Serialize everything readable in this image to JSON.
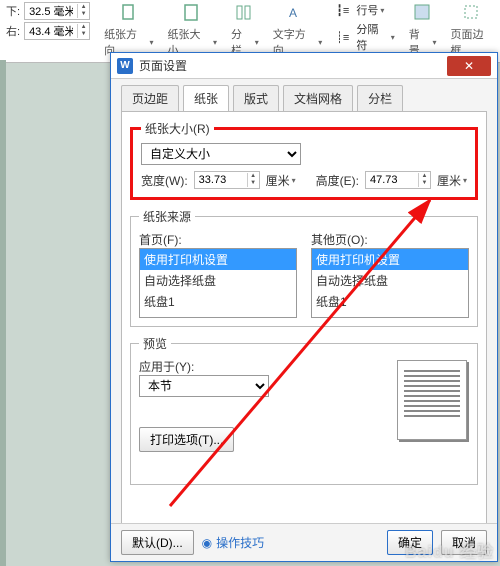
{
  "ribbon": {
    "margins": {
      "btm_label": "下:",
      "btm_value": "32.5 毫米",
      "right_label": "右:",
      "right_value": "43.4 毫米"
    },
    "items": {
      "orient": "纸张方向",
      "size": "纸张大小",
      "columns": "分栏",
      "textdir": "文字方向",
      "lineno_icon": "┇≡",
      "lineno": "行号",
      "sep_icon": "┊≡",
      "sep": "分隔符",
      "bg": "背景",
      "border": "页面边框"
    }
  },
  "dialog": {
    "title": "页面设置",
    "tabs": {
      "t1": "页边距",
      "t2": "纸张",
      "t3": "版式",
      "t4": "文档网格",
      "t5": "分栏"
    },
    "paper_size": {
      "legend": "纸张大小(R)",
      "select_value": "自定义大小",
      "width_label": "宽度(W):",
      "width_value": "33.73",
      "height_label": "高度(E):",
      "height_value": "47.73",
      "unit": "厘米"
    },
    "paper_source": {
      "legend": "纸张来源",
      "first_label": "首页(F):",
      "other_label": "其他页(O):",
      "opt1": "使用打印机设置",
      "opt2": "自动选择纸盘",
      "opt3": "纸盘1"
    },
    "preview": {
      "legend": "预览",
      "apply_label": "应用于(Y):",
      "apply_value": "本节",
      "print_opts": "打印选项(T)..."
    },
    "buttons": {
      "defaults": "默认(D)...",
      "tip": "操作技巧",
      "ok": "确定",
      "cancel": "取消"
    }
  }
}
